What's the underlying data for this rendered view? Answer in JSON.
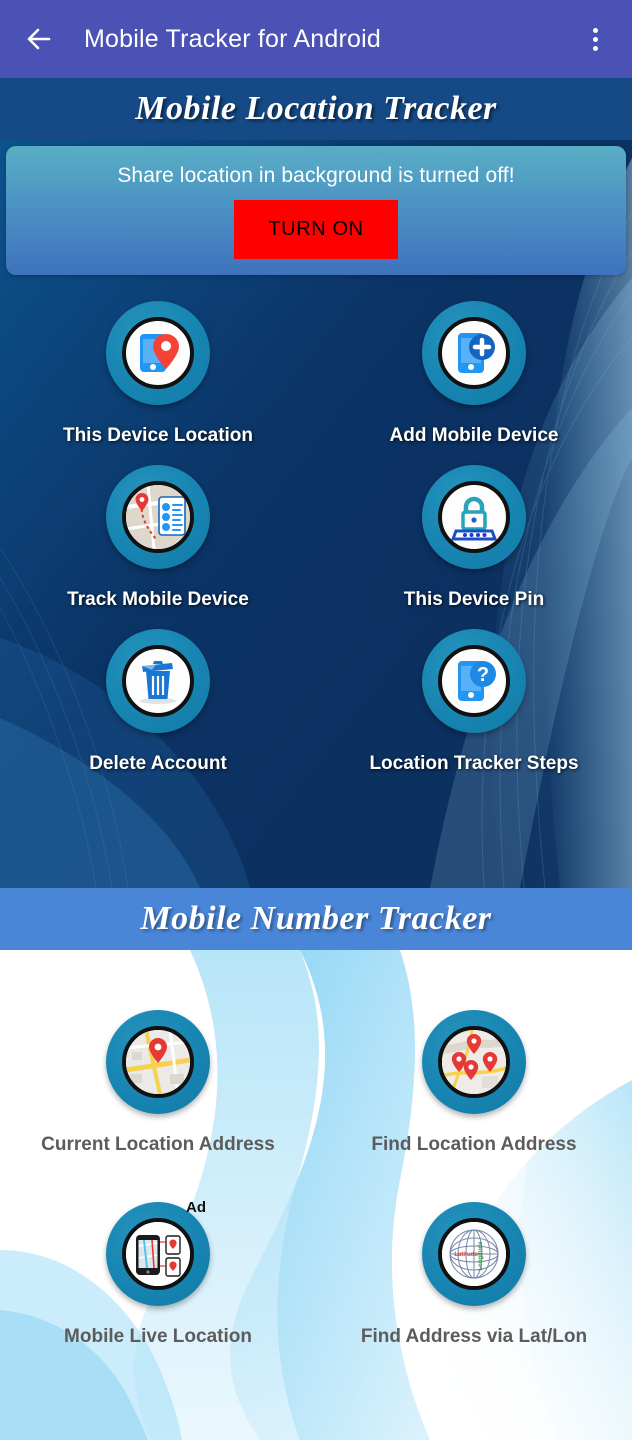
{
  "appbar": {
    "back_icon": "arrow-left-icon",
    "title": "Mobile Tracker for Android",
    "overflow_icon": "more-vertical-icon"
  },
  "location_section": {
    "header": "Mobile Location Tracker",
    "notice": {
      "message": "Share location in background is turned off!",
      "button_label": "TURN ON",
      "button_color": "#ff0000",
      "button_text_color": "#000000"
    },
    "items": [
      {
        "label": "This Device Location",
        "icon": "phone-pin-icon"
      },
      {
        "label": "Add Mobile Device",
        "icon": "phone-plus-icon"
      },
      {
        "label": "Track Mobile Device",
        "icon": "map-route-list-icon"
      },
      {
        "label": "This Device Pin",
        "icon": "lock-keypad-icon"
      },
      {
        "label": "Delete Account",
        "icon": "trash-icon"
      },
      {
        "label": "Location Tracker Steps",
        "icon": "phone-question-icon"
      }
    ]
  },
  "number_section": {
    "header": "Mobile Number Tracker",
    "items": [
      {
        "label": "Current Location Address",
        "icon": "map-single-pin-icon",
        "ad": ""
      },
      {
        "label": "Find Location Address",
        "icon": "map-multi-pin-icon",
        "ad": ""
      },
      {
        "label": "Mobile Live Location",
        "icon": "phone-live-map-icon",
        "ad": "Ad"
      },
      {
        "label": "Find Address via Lat/Lon",
        "icon": "globe-latlon-icon",
        "ad": ""
      }
    ],
    "globe_labels": {
      "latitude": "Latitude",
      "longitude": "Longitude"
    }
  },
  "colors": {
    "appbar": "#4a52b5",
    "location_header": "#154a86",
    "number_header": "#4a86d8",
    "icon_ring": "#1683b0",
    "accent_red": "#ff0000"
  }
}
